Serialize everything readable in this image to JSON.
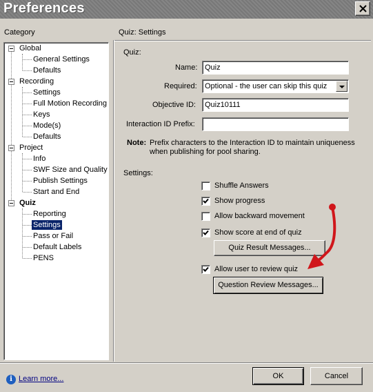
{
  "window": {
    "title": "Preferences"
  },
  "category": {
    "label": "Category",
    "tree": [
      {
        "id": "global",
        "label": "Global",
        "children": [
          "General Settings",
          "Defaults"
        ]
      },
      {
        "id": "recording",
        "label": "Recording",
        "children": [
          "Settings",
          "Full Motion Recording",
          "Keys",
          "Mode(s)",
          "Defaults"
        ]
      },
      {
        "id": "project",
        "label": "Project",
        "children": [
          "Info",
          "SWF Size and Quality",
          "Publish Settings",
          "Start and End"
        ]
      },
      {
        "id": "quiz",
        "label": "Quiz",
        "children": [
          "Reporting",
          "Settings",
          "Pass or Fail",
          "Default Labels",
          "PENS"
        ]
      }
    ],
    "selected": "Quiz > Settings"
  },
  "panel": {
    "heading": "Quiz: Settings",
    "quiz_section": "Quiz:",
    "name_label": "Name:",
    "name_value": "Quiz",
    "required_label": "Required:",
    "required_value": "Optional - the user can skip this quiz",
    "objective_label": "Objective ID:",
    "objective_value": "Quiz10111",
    "interaction_label": "Interaction ID Prefix:",
    "interaction_value": "",
    "note_label": "Note:",
    "note_line1": "Prefix characters to the Interaction ID to maintain uniqueness",
    "note_line2": "when publishing for pool sharing.",
    "settings_section": "Settings:",
    "options": [
      {
        "label": "Shuffle Answers",
        "checked": false
      },
      {
        "label": "Show progress",
        "checked": true
      },
      {
        "label": "Allow backward movement",
        "checked": false
      },
      {
        "label": "Show score at end of quiz",
        "checked": true
      }
    ],
    "result_messages_button": "Quiz Result Messages...",
    "review_option": {
      "label": "Allow user to review quiz",
      "checked": true
    },
    "review_messages_button": "Question Review Messages...",
    "annotation_color": "#d0161b"
  },
  "footer": {
    "learn_more": "Learn more...",
    "ok": "OK",
    "cancel": "Cancel"
  }
}
